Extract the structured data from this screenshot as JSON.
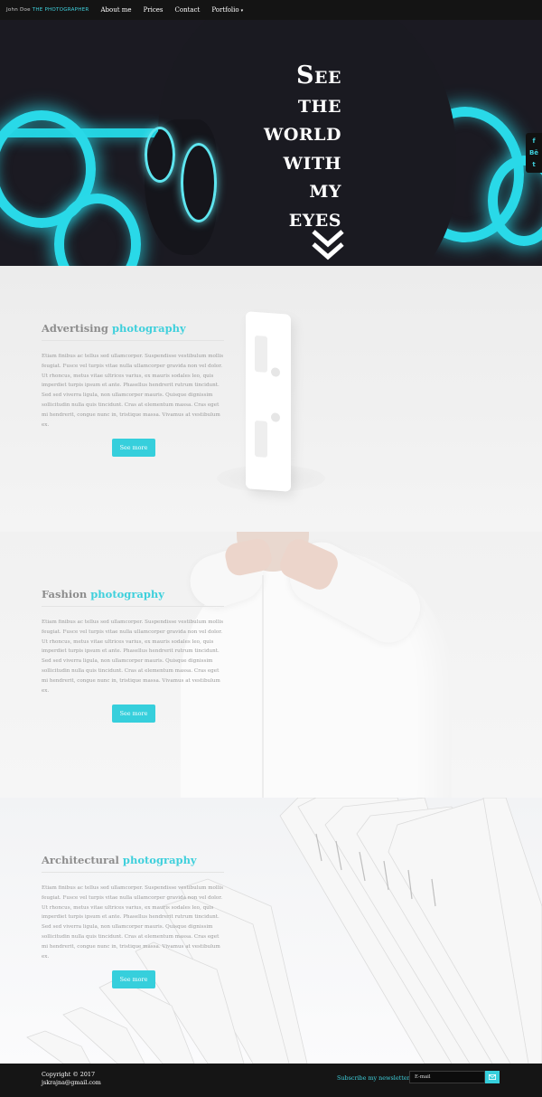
{
  "nav": {
    "brand_name": "John Doe",
    "brand_tagline": "THE PHOTOGRAPHER",
    "items": [
      {
        "label": "About me"
      },
      {
        "label": "Prices"
      },
      {
        "label": "Contact"
      },
      {
        "label": "Portfolio"
      }
    ]
  },
  "hero": {
    "title_lines": [
      "See",
      "the",
      "world",
      "with",
      "my",
      "eyes"
    ],
    "social": [
      {
        "icon": "facebook-icon",
        "glyph": "f"
      },
      {
        "icon": "behance-icon",
        "glyph": "Bē"
      },
      {
        "icon": "twitter-icon",
        "glyph": "t"
      }
    ]
  },
  "sections": [
    {
      "title": "Advertising",
      "title_accent": "photography",
      "text": "Etiam finibus ac tellus sed ullamcorper. Suspendisse vestibulum mollis feugiat. Fusce vel turpis vitae nulla ullamcorper gravida non vel dolor. Ut rhoncus, metus vitae ultrices varius, ex mauris sodales leo, quis imperdiet turpis ipsum et ante. Phasellus hendrerit rutrum tincidunt. Sed sed viverra ligula, non ullamcorper mauris. Quisque dignissim sollicitudin nulla quis tincidunt. Cras at elementum massa. Cras eget mi hendrerit, congue nunc in, tristique massa. Vivamus at vestibulum ex.",
      "button": "See more"
    },
    {
      "title": "Fashion",
      "title_accent": "photography",
      "text": "Etiam finibus ac tellus sed ullamcorper. Suspendisse vestibulum mollis feugiat. Fusce vel turpis vitae nulla ullamcorper gravida non vel dolor. Ut rhoncus, metus vitae ultrices varius, ex mauris sodales leo, quis imperdiet turpis ipsum et ante. Phasellus hendrerit rutrum tincidunt. Sed sed viverra ligula, non ullamcorper mauris. Quisque dignissim sollicitudin nulla quis tincidunt. Cras at elementum massa. Cras eget mi hendrerit, congue nunc in, tristique massa. Vivamus at vestibulum ex.",
      "button": "See more"
    },
    {
      "title": "Architectural",
      "title_accent": "photography",
      "text": "Etiam finibus ac tellus sed ullamcorper. Suspendisse vestibulum mollis feugiat. Fusce vel turpis vitae nulla ullamcorper gravida non vel dolor. Ut rhoncus, metus vitae ultrices varius, ex mauris sodales leo, quis imperdiet turpis ipsum et ante. Phasellus hendrerit rutrum tincidunt. Sed sed viverra ligula, non ullamcorper mauris. Quisque dignissim sollicitudin nulla quis tincidunt. Cras at elementum massa. Cras eget mi hendrerit, congue nunc in, tristique massa. Vivamus at vestibulum ex.",
      "button": "See more"
    }
  ],
  "footer": {
    "copyright": "Copyright © 2017",
    "email": "jskrajna@gmail.com",
    "newsletter_label": "Subscribe my newsletter",
    "email_placeholder": "E-mail"
  },
  "colors": {
    "accent": "#3fd0dc",
    "nav_bg": "#141414",
    "footer_bg": "#151515",
    "neon": "#29d9e8"
  }
}
